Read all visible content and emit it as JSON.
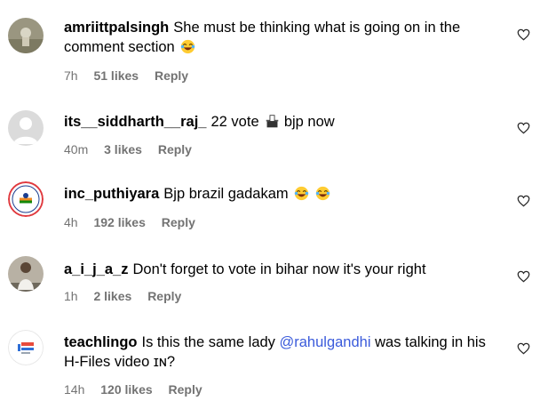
{
  "comments": [
    {
      "username": "amriittpalsingh",
      "text": "She must be thinking what is going on in the comment section",
      "emoji": "laughing-emoji",
      "time": "7h",
      "likes": "51 likes",
      "reply": "Reply"
    },
    {
      "username": "its__siddharth__raj_",
      "text_before": "22 vote",
      "text_after": "bjp now",
      "emoji": "ballot-box-emoji",
      "time": "40m",
      "likes": "3 likes",
      "reply": "Reply"
    },
    {
      "username": "inc_puthiyara",
      "text": "Bjp brazil gadakam",
      "emoji": "laughing-emoji",
      "emoji_count": 2,
      "time": "4h",
      "likes": "192 likes",
      "reply": "Reply"
    },
    {
      "username": "a_i_j_a_z",
      "text": "Don't forget to vote in bihar now it's your right",
      "time": "1h",
      "likes": "2 likes",
      "reply": "Reply"
    },
    {
      "username": "teachlingo",
      "text_before": "Is this the same lady",
      "mention": "@rahulgandhi",
      "text_after": "was talking in his H-Files video ɪɴ?",
      "time": "14h",
      "likes": "120 likes",
      "reply": "Reply"
    }
  ],
  "colors": {
    "meta": "#737373",
    "mention": "#3b5bdb",
    "background": "#ffffff"
  }
}
